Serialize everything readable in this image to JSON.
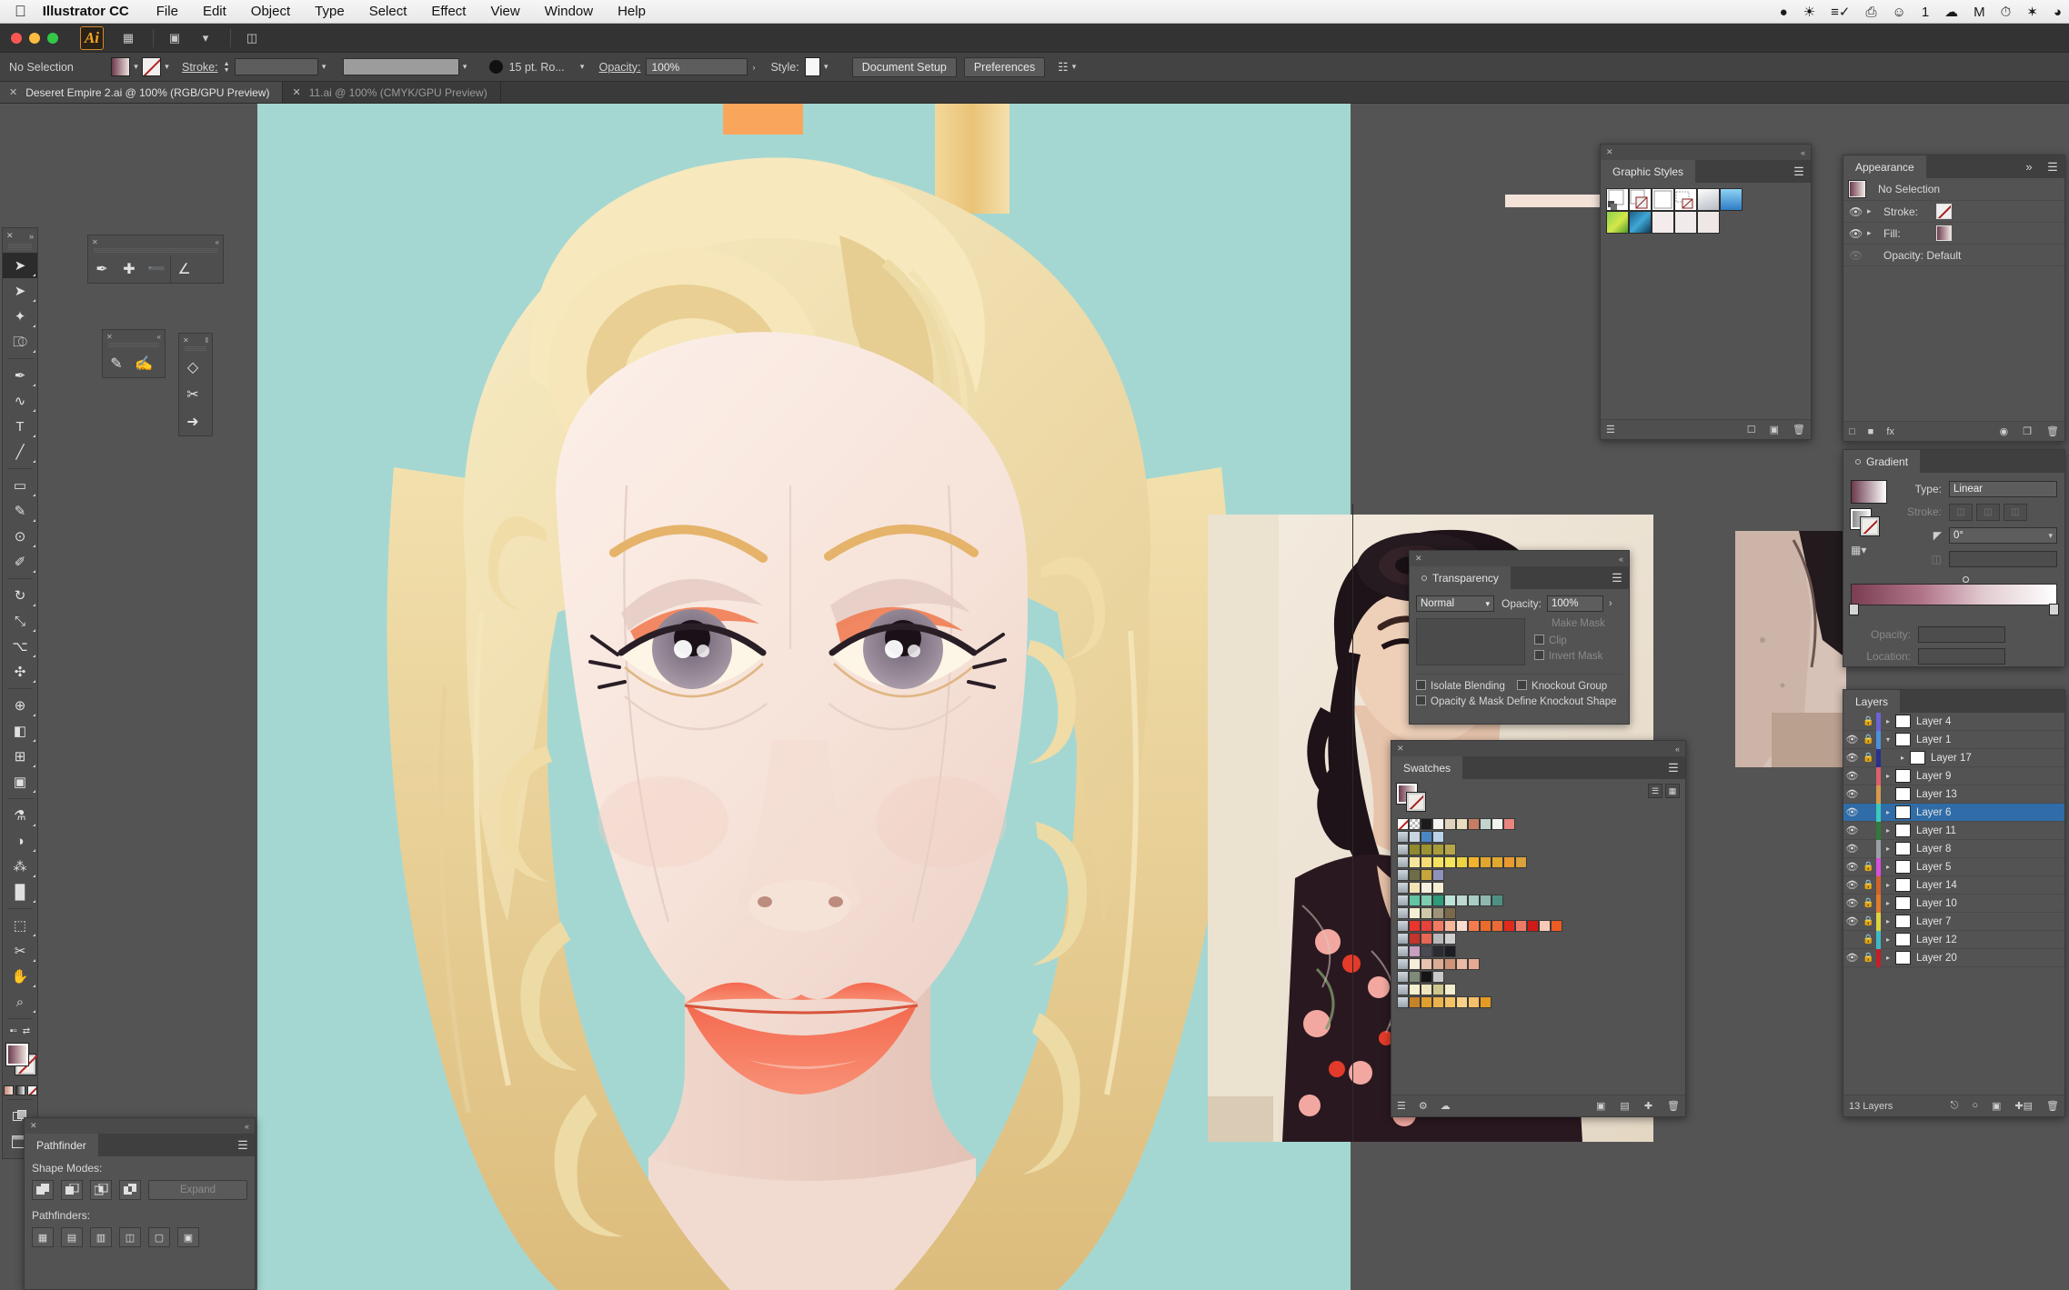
{
  "menubar": {
    "apple_icon": "apple-icon",
    "app_name": "Illustrator CC",
    "items": [
      "File",
      "Edit",
      "Object",
      "Type",
      "Select",
      "Effect",
      "View",
      "Window",
      "Help"
    ],
    "status_icons": [
      "penguin-icon",
      "colorwheel-icon",
      "flagged-mail-icon",
      "screenshot-icon",
      "wechat-icon",
      "cloud-icon",
      "mendeley-icon",
      "timemachine-icon",
      "bluetooth-icon",
      "wifi-icon"
    ],
    "status_count": "1"
  },
  "appbar": {
    "logo_text": "Ai",
    "icons": [
      "bridge-icon",
      "stock-icon",
      "arrange-documents-icon",
      "workspace-switcher-icon"
    ],
    "window_buttons": [
      "close",
      "minimize",
      "zoom"
    ]
  },
  "optionsbar": {
    "selection_status": "No Selection",
    "fill_label": "fill-swatch",
    "stroke_swatch_label": "stroke-swatch",
    "stroke_label": "Stroke:",
    "stroke_weight": "",
    "brush_label": "15 pt. Ro...",
    "opacity_label": "Opacity:",
    "opacity_value": "100%",
    "style_label": "Style:",
    "document_setup": "Document Setup",
    "preferences": "Preferences"
  },
  "doctabs": [
    {
      "title": "Deseret Empire 2.ai @ 100% (RGB/GPU Preview)",
      "active": true
    },
    {
      "title": "11.ai @ 100% (CMYK/GPU Preview)",
      "active": false
    }
  ],
  "toolbar": {
    "tools": [
      {
        "name": "selection-tool",
        "glyph": "➤",
        "active": true
      },
      {
        "name": "direct-selection-tool",
        "glyph": "➤",
        "active": false
      },
      {
        "name": "magic-wand-tool",
        "glyph": "✦",
        "active": false
      },
      {
        "name": "lasso-tool",
        "glyph": "⎄",
        "active": false
      },
      {
        "name": "pen-tool",
        "glyph": "✒",
        "active": false
      },
      {
        "name": "curvature-tool",
        "glyph": "∿",
        "active": false
      },
      {
        "name": "type-tool",
        "glyph": "T",
        "active": false
      },
      {
        "name": "line-segment-tool",
        "glyph": "╱",
        "active": false
      },
      {
        "name": "rectangle-tool",
        "glyph": "▭",
        "active": false
      },
      {
        "name": "paintbrush-tool",
        "glyph": "✎",
        "active": false
      },
      {
        "name": "shaper-tool",
        "glyph": "⊙",
        "active": false
      },
      {
        "name": "pencil-tool",
        "glyph": "✐",
        "active": false
      },
      {
        "name": "rotate-tool",
        "glyph": "↻",
        "active": false
      },
      {
        "name": "scale-tool",
        "glyph": "⤡",
        "active": false
      },
      {
        "name": "width-tool",
        "glyph": "⌥",
        "active": false
      },
      {
        "name": "free-transform-tool",
        "glyph": "✣",
        "active": false
      },
      {
        "name": "shape-builder-tool",
        "glyph": "⊕",
        "active": false
      },
      {
        "name": "perspective-grid-tool",
        "glyph": "◧",
        "active": false
      },
      {
        "name": "mesh-tool",
        "glyph": "⊞",
        "active": false
      },
      {
        "name": "gradient-tool",
        "glyph": "▣",
        "active": false
      },
      {
        "name": "eyedropper-tool",
        "glyph": "⚗",
        "active": false
      },
      {
        "name": "blend-tool",
        "glyph": "◑",
        "active": false
      },
      {
        "name": "symbol-sprayer-tool",
        "glyph": "⁂",
        "active": false
      },
      {
        "name": "column-graph-tool",
        "glyph": "█",
        "active": false
      },
      {
        "name": "artboard-tool",
        "glyph": "⬚",
        "active": false
      },
      {
        "name": "slice-tool",
        "glyph": "✂",
        "active": false
      },
      {
        "name": "hand-tool",
        "glyph": "✋",
        "active": false
      },
      {
        "name": "zoom-tool",
        "glyph": "⌕",
        "active": false
      }
    ],
    "fill_stroke": {
      "fill_name": "fill-color",
      "stroke_name": "stroke-color-none"
    },
    "mini_buttons": [
      "color-mode",
      "gradient-mode",
      "none-mode"
    ],
    "draw_modes": [
      "draw-normal",
      "draw-behind",
      "draw-inside"
    ],
    "screen_mode": "screen-mode-toggle"
  },
  "tearoffs": [
    {
      "name": "pen-tools-palette",
      "items": [
        "pen-tool",
        "add-anchor-point-tool",
        "delete-anchor-point-tool",
        "anchor-point-tool"
      ]
    },
    {
      "name": "brush-tools-palette",
      "items": [
        "paintbrush-tool",
        "blob-brush-tool"
      ]
    },
    {
      "name": "eraser-tools-palette",
      "items": [
        "eraser-tool",
        "scissors-tool",
        "knife-tool"
      ]
    }
  ],
  "panels": {
    "graphic_styles": {
      "title": "Graphic Styles",
      "swatches_row1": [
        "#ffffff",
        "#ffffff",
        "#ffffff",
        "#ffffff",
        "#c9cdd2",
        "#4da2e0"
      ],
      "swatches_row2": [
        "#6ac04a",
        "#1c7fb4",
        "#f3eceb",
        "#f0eaea",
        "#efe7e6"
      ],
      "footer_icons": [
        "graphic-styles-libraries-icon",
        "break-link-icon",
        "new-style-icon",
        "delete-style-icon"
      ]
    },
    "appearance": {
      "title": "Appearance",
      "target_label": "No Selection",
      "rows": [
        {
          "label": "Stroke:",
          "swatch": "none"
        },
        {
          "label": "Fill:",
          "swatch": "gradient"
        }
      ],
      "opacity_row": "Opacity: Default",
      "footer_icons": [
        "add-new-stroke-icon",
        "add-new-fill-icon",
        "add-new-effect-icon",
        "clear-appearance-icon",
        "duplicate-item-icon",
        "delete-item-icon"
      ]
    },
    "gradient": {
      "title": "Gradient",
      "type_label": "Type:",
      "type_value": "Linear",
      "stroke_label": "Stroke:",
      "angle_label": "angle",
      "angle_value": "0°",
      "aspect_label": "aspect-ratio",
      "opacity_label": "Opacity:",
      "location_label": "Location:",
      "gradient_start": "#7a3d52",
      "gradient_end": "#ffffff"
    },
    "layers": {
      "title": "Layers",
      "rows": [
        {
          "name": "Layer 4",
          "visible": false,
          "locked": true,
          "color": "#6a63d6",
          "expandable": true,
          "expanded": false,
          "indent": 0,
          "selected": false
        },
        {
          "name": "Layer 1",
          "visible": true,
          "locked": true,
          "color": "#4a90d9",
          "expandable": true,
          "expanded": true,
          "indent": 0,
          "selected": false
        },
        {
          "name": "Layer 17",
          "visible": true,
          "locked": true,
          "color": "#2d2f8f",
          "expandable": true,
          "expanded": false,
          "indent": 1,
          "selected": false
        },
        {
          "name": "Layer 9",
          "visible": true,
          "locked": false,
          "color": "#e05e6a",
          "expandable": true,
          "expanded": false,
          "indent": 0,
          "selected": false
        },
        {
          "name": "Layer 13",
          "visible": true,
          "locked": false,
          "color": "#d39b4e",
          "expandable": false,
          "expanded": false,
          "indent": 0,
          "selected": false
        },
        {
          "name": "Layer 6",
          "visible": true,
          "locked": false,
          "color": "#3fc9b8",
          "expandable": true,
          "expanded": false,
          "indent": 0,
          "selected": true
        },
        {
          "name": "Layer 11",
          "visible": true,
          "locked": false,
          "color": "#2f7a3c",
          "expandable": true,
          "expanded": false,
          "indent": 0,
          "selected": false
        },
        {
          "name": "Layer 8",
          "visible": true,
          "locked": false,
          "color": "#9aa0a6",
          "expandable": true,
          "expanded": false,
          "indent": 0,
          "selected": false
        },
        {
          "name": "Layer 5",
          "visible": true,
          "locked": true,
          "color": "#d94fd9",
          "expandable": true,
          "expanded": false,
          "indent": 0,
          "selected": false
        },
        {
          "name": "Layer 14",
          "visible": true,
          "locked": true,
          "color": "#d1622a",
          "expandable": true,
          "expanded": false,
          "indent": 0,
          "selected": false
        },
        {
          "name": "Layer 10",
          "visible": true,
          "locked": true,
          "color": "#e07b2a",
          "expandable": true,
          "expanded": false,
          "indent": 0,
          "selected": false
        },
        {
          "name": "Layer 7",
          "visible": true,
          "locked": true,
          "color": "#d9d43f",
          "expandable": true,
          "expanded": false,
          "indent": 0,
          "selected": false
        },
        {
          "name": "Layer 12",
          "visible": false,
          "locked": true,
          "color": "#3fb7c9",
          "expandable": true,
          "expanded": false,
          "indent": 0,
          "selected": false
        },
        {
          "name": "Layer 20",
          "visible": true,
          "locked": true,
          "color": "#c41f27",
          "expandable": true,
          "expanded": false,
          "indent": 0,
          "selected": false
        }
      ],
      "count_label": "13 Layers",
      "footer_icons": [
        "locate-object-icon",
        "make-clipping-mask-icon",
        "create-new-sublayer-icon",
        "create-new-layer-icon",
        "delete-selection-icon"
      ]
    },
    "transparency": {
      "title": "Transparency",
      "blend_mode": "Normal",
      "opacity_label": "Opacity:",
      "opacity_value": "100%",
      "make_mask": "Make Mask",
      "clip": "Clip",
      "invert_mask": "Invert Mask",
      "isolate_blending": "Isolate Blending",
      "knockout_group": "Knockout Group",
      "opacity_mask_knockout": "Opacity & Mask Define Knockout Shape"
    },
    "swatches": {
      "title": "Swatches",
      "view_icons": [
        "list-view-icon",
        "grid-view-icon"
      ],
      "rows": [
        [
          "none",
          "registration",
          "#1b1b1b",
          "#f5f4f0",
          "#ded3bd",
          "#e8dcc0",
          "#c77d62",
          "#c3d4cc",
          "#f2f2ee",
          "#e8857f"
        ],
        [
          "#c8d4e0",
          "#4b86c4",
          "#b9d2ea"
        ],
        [
          "#8d8b2e",
          "#9b9430",
          "#aa9c38",
          "#b6a54a"
        ],
        [
          "#f6e59d",
          "#f7db74",
          "#f5e15f",
          "#f4e35b",
          "#ebd341",
          "#f4b32c",
          "#e0a62e",
          "#dfa92f",
          "#e89a31",
          "#d9a23a"
        ],
        [
          "#6e6e46",
          "#c7a63a",
          "#8f92b8"
        ],
        [
          "#f2e3b6",
          "#f7f0de",
          "#f7edd2"
        ],
        [
          "#62c4a4",
          "#7ecdb0",
          "#2e9b7a",
          "#bde3d8",
          "#bcd8d1",
          "#a9ccc5",
          "#8fb8af",
          "#4d9182"
        ],
        [
          "#f4efd4",
          "#cfc8a8",
          "#9e9378",
          "#7a6a4a"
        ],
        [
          "#e8352d",
          "#e6413a",
          "#f07a62",
          "#f6b79c",
          "#f9ddd0",
          "#f57a4e",
          "#ec6a2c",
          "#ea6b35",
          "#e02a1c",
          "#ef7a68",
          "#d01b16",
          "#f9c9b8",
          "#ec5c22"
        ],
        [
          "#c1352c",
          "#e86654",
          "#b8b8b8",
          "#cfcfcf"
        ],
        [
          "#c69fc1",
          "#4a4a55",
          "#2b2b33",
          "#1c1c22"
        ],
        [
          "#f7ecd9",
          "#e5c3ae",
          "#dcab93",
          "#cf9377",
          "#e9b9a4",
          "#e8a992"
        ],
        [
          "#7f8a79",
          "#141414",
          "#c9c9c9"
        ],
        [
          "#f5eecf",
          "#efe5bd",
          "#cfc68e",
          "#f3edd0"
        ],
        [
          "#c4832a",
          "#e0a12f",
          "#eab24c",
          "#f2c265",
          "#f6d089",
          "#f4c06a",
          "#e59a24"
        ]
      ],
      "footer_icons": [
        "swatch-libraries-icon",
        "show-kind-icon",
        "swatch-options-icon",
        "new-color-group-icon",
        "new-swatch-icon",
        "delete-swatch-icon"
      ]
    },
    "pathfinder": {
      "title": "Pathfinder",
      "shape_modes_label": "Shape Modes:",
      "shape_modes": [
        "unite-icon",
        "minus-front-icon",
        "intersect-icon",
        "exclude-icon"
      ],
      "expand_label": "Expand",
      "pathfinders_label": "Pathfinders:",
      "pathfinders": [
        "divide-icon",
        "trim-icon",
        "merge-icon",
        "crop-icon",
        "outline-icon",
        "minus-back-icon"
      ]
    }
  },
  "artwork": {
    "description": "vector portrait illustration of blonde woman",
    "background_color": "#a5d7d2",
    "hair_light": "#f5e3b4",
    "hair_mid": "#edd89d",
    "hair_shadow": "#e0c489",
    "skin_light": "#f7e6dd",
    "skin_mid": "#f3ddd4",
    "lips_color": "#f4745a",
    "eye_iris": "#8b7f8e",
    "accent_orange": "#f9a65c",
    "accent_pink": "#f08a7e",
    "accent_gold": "#ecc57f"
  },
  "reference_photo": {
    "description": "pin-up style photo of dark-haired woman with pink flower and floral dress",
    "background": "#efe6d5",
    "hair": "#1d1318",
    "flower": "#f2b4c4",
    "dress": "#2a1820"
  }
}
